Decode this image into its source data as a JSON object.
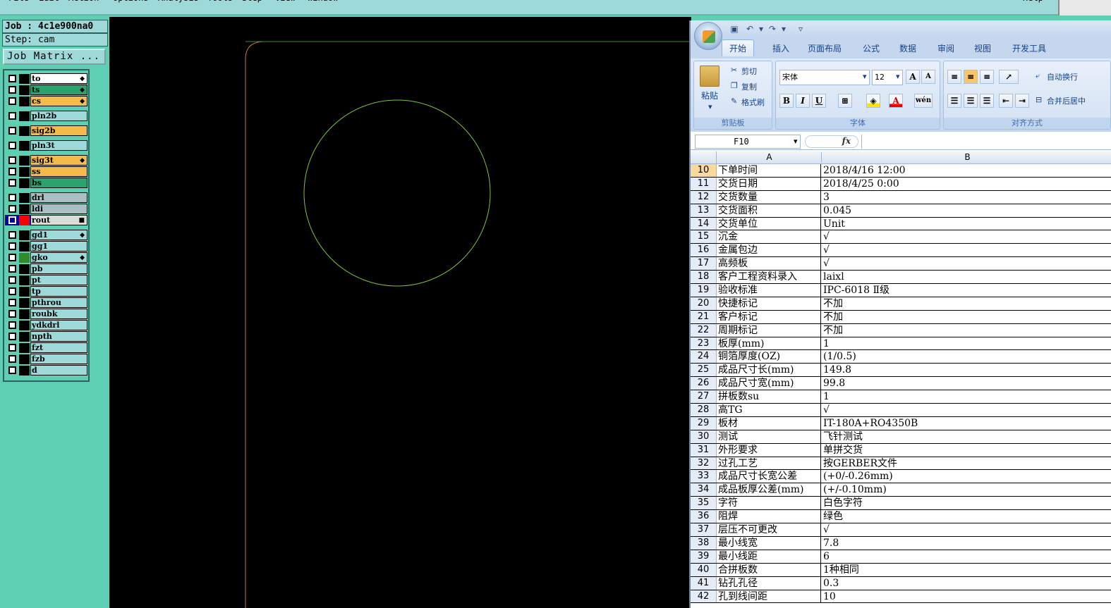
{
  "menubar": {
    "items": [
      "File",
      "Edit",
      "Action",
      "Options",
      "Analysis",
      "Tools",
      "Step",
      "View",
      "Window",
      "Help"
    ]
  },
  "job": {
    "label": "Job : 4c1e900na0",
    "step": "Step: cam",
    "matrix_button": "Job Matrix ..."
  },
  "layers": [
    {
      "name": "to",
      "color": "#ffffff",
      "mark": true,
      "sel": false
    },
    {
      "name": "ts",
      "color": "#2aa36f",
      "mark": true,
      "sel": false
    },
    {
      "name": "cs",
      "color": "#f5bb4a",
      "mark": true,
      "sel": false
    },
    {
      "name": "pln2b",
      "color": "#9ed9d9",
      "mark": false,
      "sel": false
    },
    {
      "name": "sig2b",
      "color": "#f5bb4a",
      "mark": false,
      "sel": false
    },
    {
      "name": "pln3t",
      "color": "#9ed9d9",
      "mark": false,
      "sel": false
    },
    {
      "name": "sig3t",
      "color": "#f5bb4a",
      "mark": true,
      "sel": false
    },
    {
      "name": "ss",
      "color": "#f5bb4a",
      "mark": false,
      "sel": false
    },
    {
      "name": "bs",
      "color": "#2aa36f",
      "mark": false,
      "sel": false
    },
    {
      "name": "drl",
      "color": "#a9bfc4",
      "mark": false,
      "sel": false
    },
    {
      "name": "ldi",
      "color": "#a9bfc4",
      "mark": false,
      "sel": false
    },
    {
      "name": "rout",
      "color": "#dcdcdc",
      "mark": true,
      "sel": true
    },
    {
      "name": "gd1",
      "color": "#9ed9d9",
      "mark": true,
      "sel": false
    },
    {
      "name": "gg1",
      "color": "#9ed9d9",
      "mark": false,
      "sel": false
    },
    {
      "name": "gko",
      "color": "#9ed9d9",
      "mark": true,
      "sel": false,
      "swatch": "#2e8b2e"
    },
    {
      "name": "pb",
      "color": "#9ed9d9",
      "mark": false,
      "sel": false
    },
    {
      "name": "pt",
      "color": "#9ed9d9",
      "mark": false,
      "sel": false
    },
    {
      "name": "tp",
      "color": "#9ed9d9",
      "mark": false,
      "sel": false
    },
    {
      "name": "pthrou",
      "color": "#9ed9d9",
      "mark": false,
      "sel": false
    },
    {
      "name": "roubk",
      "color": "#9ed9d9",
      "mark": false,
      "sel": false
    },
    {
      "name": "ydkdrl",
      "color": "#9ed9d9",
      "mark": false,
      "sel": false
    },
    {
      "name": "npth",
      "color": "#9ed9d9",
      "mark": false,
      "sel": false
    },
    {
      "name": "fzt",
      "color": "#9ed9d9",
      "mark": false,
      "sel": false
    },
    {
      "name": "fzb",
      "color": "#9ed9d9",
      "mark": false,
      "sel": false
    },
    {
      "name": "d",
      "color": "#9ed9d9",
      "mark": false,
      "sel": false
    }
  ],
  "excel": {
    "tabs": [
      "开始",
      "插入",
      "页面布局",
      "公式",
      "数据",
      "审阅",
      "视图",
      "开发工具"
    ],
    "clipboard": {
      "paste": "粘贴",
      "cut": "剪切",
      "copy": "复制",
      "format_painter": "格式刷",
      "group": "剪贴板"
    },
    "font": {
      "name": "宋体",
      "size": "12",
      "group": "字体",
      "bold": "B",
      "italic": "I",
      "underline": "U"
    },
    "align": {
      "wrap": "自动换行",
      "merge": "合并后居中",
      "group": "对齐方式"
    },
    "namebox": "F10",
    "fx": "fx",
    "col_a": "A",
    "col_b": "B",
    "rows": [
      {
        "n": "10",
        "a": "下单时间",
        "b": "2018/4/16 12:00"
      },
      {
        "n": "11",
        "a": "交货日期",
        "b": "2018/4/25 0:00"
      },
      {
        "n": "12",
        "a": "交货数量",
        "b": "3"
      },
      {
        "n": "13",
        "a": "交货面积",
        "b": "0.045"
      },
      {
        "n": "14",
        "a": "交货单位",
        "b": "Unit"
      },
      {
        "n": "15",
        "a": "沉金",
        "b": "√"
      },
      {
        "n": "16",
        "a": "金属包边",
        "b": "√"
      },
      {
        "n": "17",
        "a": "高频板",
        "b": "√"
      },
      {
        "n": "18",
        "a": "客户工程资料录入",
        "b": "laixl"
      },
      {
        "n": "19",
        "a": "验收标准",
        "b": "IPC-6018 Ⅱ级"
      },
      {
        "n": "20",
        "a": "快捷标记",
        "b": "不加"
      },
      {
        "n": "21",
        "a": "客户标记",
        "b": "不加"
      },
      {
        "n": "22",
        "a": "周期标记",
        "b": "不加"
      },
      {
        "n": "23",
        "a": "板厚(mm)",
        "b": "1"
      },
      {
        "n": "24",
        "a": "铜箔厚度(OZ)",
        "b": "(1/0.5)"
      },
      {
        "n": "25",
        "a": "成品尺寸长(mm)",
        "b": "149.8"
      },
      {
        "n": "26",
        "a": "成品尺寸宽(mm)",
        "b": "99.8"
      },
      {
        "n": "27",
        "a": "拼板数su",
        "b": "1"
      },
      {
        "n": "28",
        "a": "高TG",
        "b": "√"
      },
      {
        "n": "29",
        "a": "板材",
        "b": "IT-180A+RO4350B"
      },
      {
        "n": "30",
        "a": "测试",
        "b": "飞针测试"
      },
      {
        "n": "31",
        "a": "外形要求",
        "b": "单拼交货"
      },
      {
        "n": "32",
        "a": "过孔工艺",
        "b": "按GERBER文件"
      },
      {
        "n": "33",
        "a": "成品尺寸长宽公差",
        "b": "(+0/-0.26mm)"
      },
      {
        "n": "34",
        "a": "成品板厚公差(mm)",
        "b": "(+/-0.10mm)"
      },
      {
        "n": "35",
        "a": "字符",
        "b": "白色字符"
      },
      {
        "n": "36",
        "a": "阻焊",
        "b": "绿色"
      },
      {
        "n": "37",
        "a": "层压不可更改",
        "b": "√"
      },
      {
        "n": "38",
        "a": "最小线宽",
        "b": "7.8"
      },
      {
        "n": "39",
        "a": "最小线距",
        "b": "6"
      },
      {
        "n": "40",
        "a": "合拼板数",
        "b": "1种相同"
      },
      {
        "n": "41",
        "a": "钻孔孔径",
        "b": "0.3"
      },
      {
        "n": "42",
        "a": "孔到线间距",
        "b": "10"
      }
    ]
  }
}
